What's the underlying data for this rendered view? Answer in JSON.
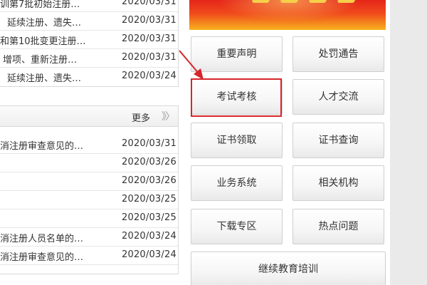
{
  "top_news": [
    {
      "title": "训第7批初始注册…",
      "date": "2020/03/31"
    },
    {
      "title": "延续注册、遗失…",
      "date": "2020/03/31"
    },
    {
      "title": "和第10批变更注册…",
      "date": "2020/03/31"
    },
    {
      "title": "增项、重新注册…",
      "date": "2020/03/31"
    },
    {
      "title": "延续注册、遗失…",
      "date": "2020/03/24"
    }
  ],
  "section": {
    "more_label": "更多",
    "more_arrows": "》〉"
  },
  "section_news": [
    {
      "title": "消注册审查意见的…",
      "date": "2020/03/31"
    },
    {
      "title": "",
      "date": "2020/03/26"
    },
    {
      "title": "",
      "date": "2020/03/26"
    },
    {
      "title": "",
      "date": "2020/03/25"
    },
    {
      "title": "",
      "date": "2020/03/25"
    },
    {
      "title": "消注册人员名单的…",
      "date": "2020/03/24"
    },
    {
      "title": "消注册审查意见的…",
      "date": "2020/03/24"
    }
  ],
  "nav_buttons": {
    "important_notice": "重要声明",
    "penalty_notice": "处罚通告",
    "exam_assessment": "考试考核",
    "talent_exchange": "人才交流",
    "certificate_collection": "证书领取",
    "certificate_query": "证书查询",
    "business_system": "业务系统",
    "related_agencies": "相关机构",
    "download_area": "下载专区",
    "hot_issues": "热点问题",
    "continuing_education": "继续教育培训"
  },
  "colors": {
    "annotation_red": "#d6262b",
    "banner_red": "#e5251a",
    "banner_orange": "#f7b21e"
  }
}
